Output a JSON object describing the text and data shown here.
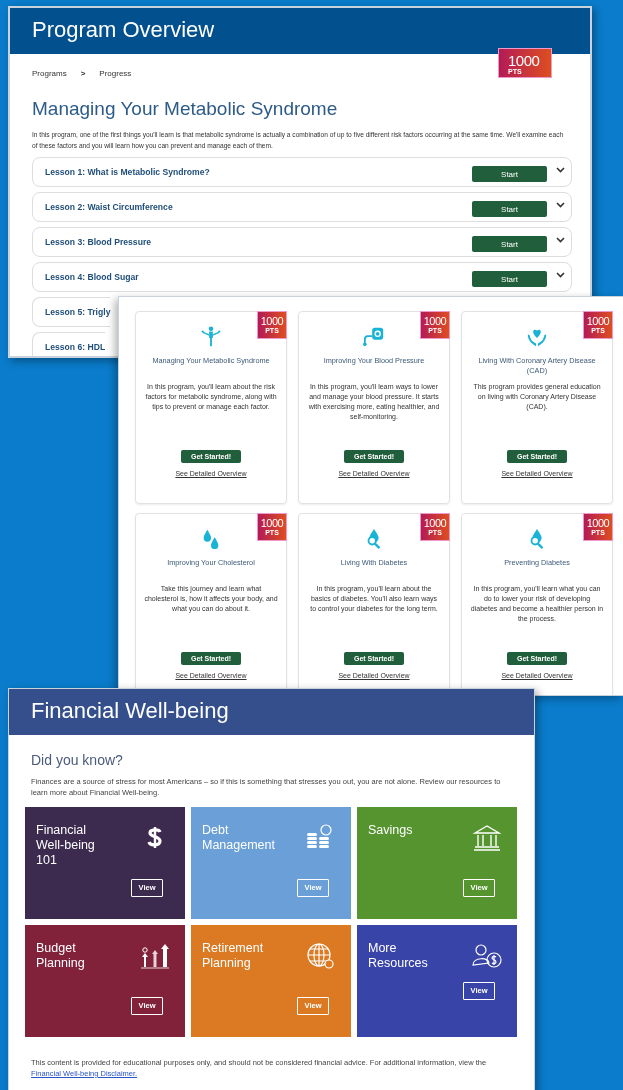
{
  "program_overview": {
    "title": "Program Overview",
    "breadcrumb": [
      "Programs",
      "Progress"
    ],
    "breadcrumb_separator": ">",
    "points": {
      "value": "1000",
      "unit": "PTS"
    },
    "heading": "Managing Your Metabolic Syndrome",
    "intro": "In this program, one of the first things you'll learn is that metabolic syndrome is actually a combination of up to five different risk factors occurring at the same time. We'll examine each of these factors and you will learn how you can prevent and manage each of them.",
    "lessons": [
      {
        "title": "Lesson 1: What is Metabolic Syndrome?",
        "button": "Start",
        "expanded": false
      },
      {
        "title": "Lesson 2: Waist Circumference",
        "button": "Start",
        "expanded": false
      },
      {
        "title": "Lesson 3: Blood Pressure",
        "button": "Start",
        "expanded": false
      },
      {
        "title": "Lesson 4: Blood Sugar",
        "button": "Start",
        "expanded": false
      },
      {
        "title": "Lesson 5: Trigly"
      },
      {
        "title": "Lesson 6: HDL"
      }
    ]
  },
  "programs": {
    "cards": [
      {
        "points": {
          "value": "1000",
          "unit": "PTS"
        },
        "title": "Managing Your Metabolic Syndrome",
        "description": "In this program, you'll learn about the risk factors for metabolic syndrome, along with tips to prevent or manage each factor.",
        "button": "Get Started!",
        "link": "See Detailed Overview"
      },
      {
        "points": {
          "value": "1000",
          "unit": "PTS"
        },
        "title": "Improving Your Blood Pressure",
        "description": "In this program, you'll learn ways to lower and manage your blood pressure. It starts with exercising more, eating healthier, and self-monitoring.",
        "button": "Get Started!",
        "link": "See Detailed Overview"
      },
      {
        "points": {
          "value": "1000",
          "unit": "PTS"
        },
        "title": "Living With Coronary Artery Disease (CAD)",
        "description": "This program provides general education on living with Coronary Artery Disease (CAD).",
        "button": "Get Started!",
        "link": "See Detailed Overview"
      },
      {
        "points": {
          "value": "1000",
          "unit": "PTS"
        },
        "title": "Improving Your Cholesterol",
        "description": "Take this journey and learn what cholesterol is, how it affects your body, and what you can do about it.",
        "button": "Get Started!",
        "link": "See Detailed Overview"
      },
      {
        "points": {
          "value": "1000",
          "unit": "PTS"
        },
        "title": "Living With Diabetes",
        "description": "In this program, you'll learn about the basics of diabetes. You'll also learn ways to control your diabetes for the long term.",
        "button": "Get Started!",
        "link": "See Detailed Overview"
      },
      {
        "points": {
          "value": "1000",
          "unit": "PTS"
        },
        "title": "Preventing Diabetes",
        "description": "In this program, you'll learn what you can do to lower your risk of developing diabetes and become a healthier person in the process.",
        "button": "Get Started!",
        "link": "See Detailed Overview"
      }
    ]
  },
  "financial": {
    "title": "Financial Well-being",
    "heading": "Did you know?",
    "intro": "Finances are a source of stress for most Americans – so if this is something that stresses you out, you are not alone. Review our resources to learn more about Financial Well-being.",
    "tiles": [
      {
        "title": "Financial Well-being 101",
        "button": "View",
        "color": "#3d2a4f"
      },
      {
        "title": "Debt Management",
        "button": "View",
        "color": "#6a9fd8"
      },
      {
        "title": "Savings",
        "button": "View",
        "color": "#55942f"
      },
      {
        "title": "Budget Planning",
        "button": "View",
        "color": "#81213a"
      },
      {
        "title": "Retirement Planning",
        "button": "View",
        "color": "#dc7a24"
      },
      {
        "title": "More Resources",
        "button": "View",
        "color": "#3944a8"
      }
    ],
    "footer": "This content is provided for educational purposes only, and should not be considered financial advice. For additional information, view the",
    "footer_link": "Financial Well-being Disclaimer."
  }
}
